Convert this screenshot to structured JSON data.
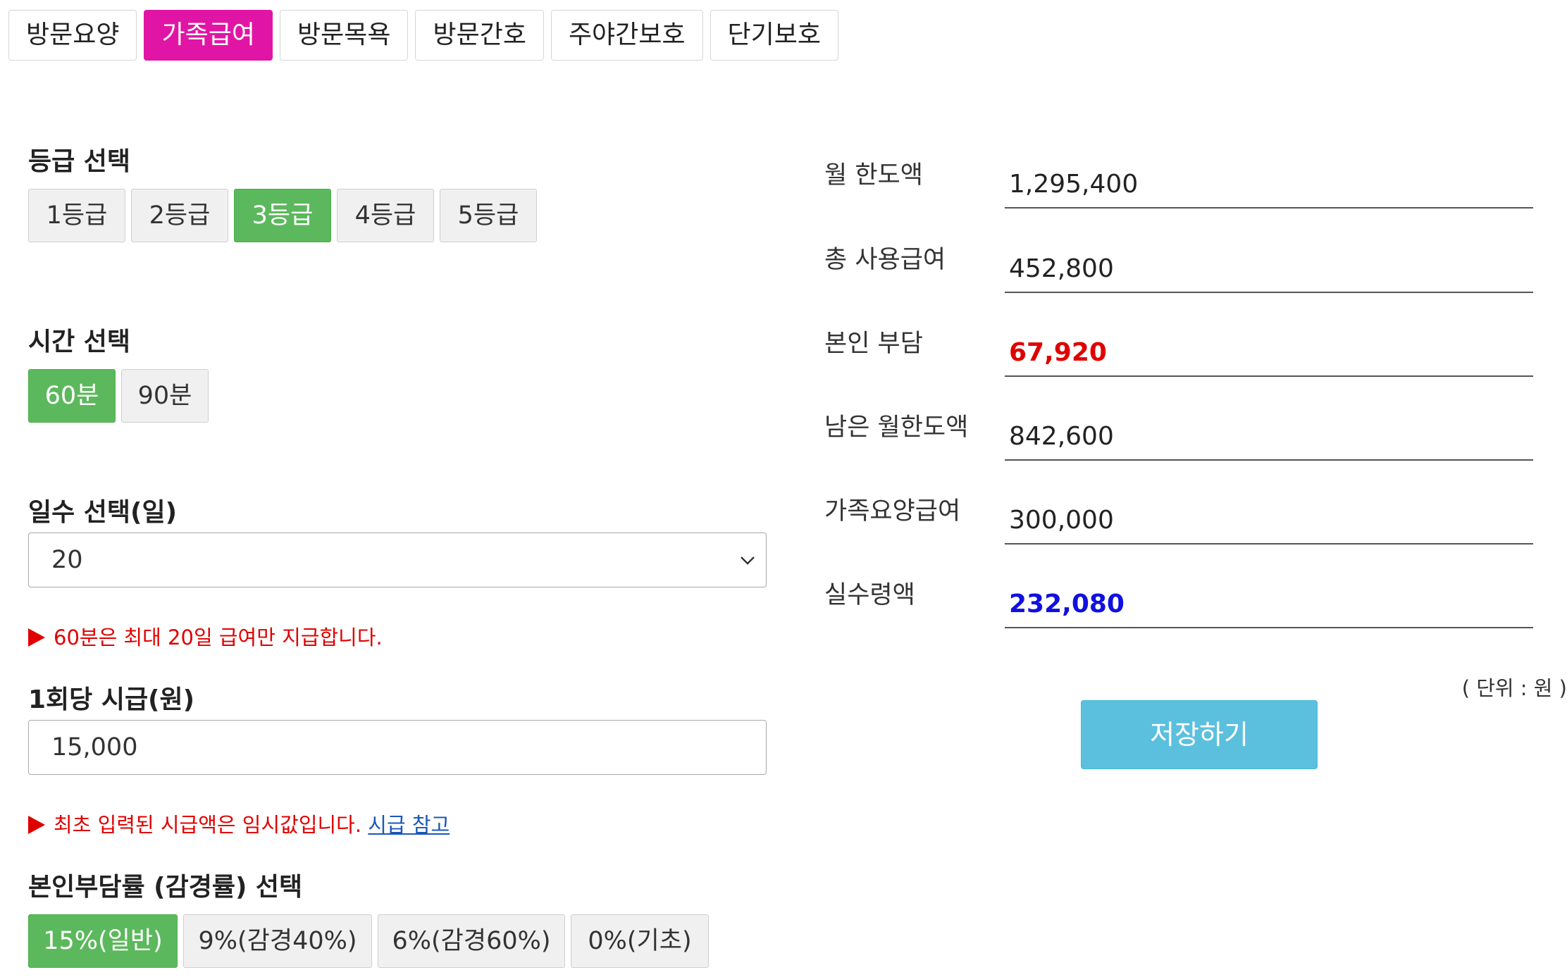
{
  "tabs": [
    {
      "label": "방문요양",
      "active": false
    },
    {
      "label": "가족급여",
      "active": true
    },
    {
      "label": "방문목욕",
      "active": false
    },
    {
      "label": "방문간호",
      "active": false
    },
    {
      "label": "주야간보호",
      "active": false
    },
    {
      "label": "단기보호",
      "active": false
    }
  ],
  "grade": {
    "label": "등급 선택",
    "options": [
      "1등급",
      "2등급",
      "3등급",
      "4등급",
      "5등급"
    ],
    "selected": "3등급"
  },
  "time": {
    "label": "시간 선택",
    "options": [
      "60분",
      "90분"
    ],
    "selected": "60분"
  },
  "days": {
    "label": "일수 선택(일)",
    "value": "20",
    "note": "60분은 최대 20일 급여만 지급합니다."
  },
  "wage": {
    "label": "1회당 시급(원)",
    "value": "15,000",
    "note": "최초 입력된 시급액은 임시값입니다.",
    "link": "시급 참고"
  },
  "copay": {
    "label": "본인부담률 (감경률) 선택",
    "options": [
      "15%(일반)",
      "9%(감경40%)",
      "6%(감경60%)",
      "0%(기초)"
    ],
    "selected": "15%(일반)"
  },
  "summary": {
    "monthly_limit": {
      "label": "월 한도액",
      "value": "1,295,400"
    },
    "total_used": {
      "label": "총 사용급여",
      "value": "452,800"
    },
    "self_pay": {
      "label": "본인 부담",
      "value": "67,920"
    },
    "remaining": {
      "label": "남은 월한도액",
      "value": "842,600"
    },
    "family_care": {
      "label": "가족요양급여",
      "value": "300,000"
    },
    "net_pay": {
      "label": "실수령액",
      "value": "232,080"
    },
    "unit": "( 단위 : 원 )",
    "save_label": "저장하기"
  },
  "colors": {
    "tab_active": "#e115a5",
    "option_active": "#5cb85c",
    "save_button": "#5bc0de",
    "self_pay": "#e00000",
    "net_pay": "#1010e0",
    "note": "#e00000",
    "link": "#1a58b5"
  }
}
